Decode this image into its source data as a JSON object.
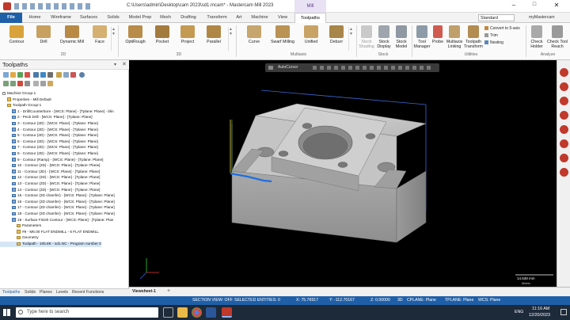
{
  "window": {
    "title": "C:\\Users\\admin\\Desktop\\cam 2023\\sd1.mcam* - Mastercam Mill 2023",
    "context_tab": "Mill",
    "workspace": "Standard",
    "account": "myMastercam"
  },
  "tabs": [
    "File",
    "Home",
    "Wireframe",
    "Surfaces",
    "Solids",
    "Model Prep",
    "Mesh",
    "Drafting",
    "Transform",
    "Art",
    "Machine",
    "View",
    "Toolpaths"
  ],
  "ribbon": {
    "buttons_2d": [
      "Contour",
      "Drill",
      "Dynamic Mill",
      "Face"
    ],
    "buttons_3d": [
      "OptiRough",
      "Pocket",
      "Project",
      "Parallel"
    ],
    "buttons_multiaxis": [
      "Curve",
      "Swarf Milling",
      "Unified",
      "Deburr"
    ],
    "buttons_stock": [
      "Stock Shading",
      "Stock Display",
      "Stock Model"
    ],
    "buttons_utilities": [
      "Tool Manager",
      "Probe",
      "Multiaxis Linking",
      "Toolpath Transform"
    ],
    "utilities_small": [
      "Convert to 5-axis",
      "Trim",
      "Nesting"
    ],
    "buttons_analyze": [
      "Check Holder",
      "Check Tool Reach"
    ],
    "groups": [
      "2D",
      "3D",
      "Multiaxis",
      "Stock",
      "Utilities",
      "Analyze"
    ]
  },
  "toolpaths_panel": {
    "title": "Toolpaths",
    "tree": [
      {
        "indent": 0,
        "kind": "pl",
        "label": "Machine Group-1"
      },
      {
        "indent": 1,
        "kind": "fi",
        "label": "Properties - Mill Default"
      },
      {
        "indent": 1,
        "kind": "fi",
        "label": "Toolpath Group-1"
      },
      {
        "indent": 2,
        "kind": "op",
        "label": "1 - Drill/Counterbore - [WCS: Plane] - [Tplane: Plane] - blin"
      },
      {
        "indent": 2,
        "kind": "op",
        "label": "2 - Peck Drill - [WCS: Plane] - [Tplane: Plane]"
      },
      {
        "indent": 2,
        "kind": "op",
        "label": "3 - Contour (2D) - [WCS: Plane] - [Tplane: Plane]"
      },
      {
        "indent": 2,
        "kind": "op",
        "label": "4 - Contour (2D) - [WCS: Plane] - [Tplane: Plane]"
      },
      {
        "indent": 2,
        "kind": "op",
        "label": "5 - Contour (2D) - [WCS: Plane] - [Tplane: Plane]"
      },
      {
        "indent": 2,
        "kind": "op",
        "label": "6 - Contour (2D) - [WCS: Plane] - [Tplane: Plane]"
      },
      {
        "indent": 2,
        "kind": "op",
        "label": "7 - Contour (2D) - [WCS: Plane] - [Tplane: Plane]"
      },
      {
        "indent": 2,
        "kind": "op",
        "label": "8 - Contour (2D) - [WCS: Plane] - [Tplane: Plane]"
      },
      {
        "indent": 2,
        "kind": "op",
        "label": "9 - Contour (Ramp) - [WCS: Plane] - [Tplane: Plane]"
      },
      {
        "indent": 2,
        "kind": "op",
        "label": "10 - Contour (2D) - [WCS: Plane] - [Tplane: Plane]"
      },
      {
        "indent": 2,
        "kind": "op",
        "label": "11 - Contour (2D) - [WCS: Plane] - [Tplane: Plane]"
      },
      {
        "indent": 2,
        "kind": "op",
        "label": "12 - Contour (2D) - [WCS: Plane] - [Tplane: Plane]"
      },
      {
        "indent": 2,
        "kind": "op",
        "label": "13 - Contour (2D) - [WCS: Plane] - [Tplane: Plane]"
      },
      {
        "indent": 2,
        "kind": "op",
        "label": "14 - Contour (2D) - [WCS: Plane] - [Tplane: Plane]"
      },
      {
        "indent": 2,
        "kind": "op",
        "label": "15 - Contour (2D chamfer) - [WCS: Plane] - [Tplane: Plane]"
      },
      {
        "indent": 2,
        "kind": "op",
        "label": "16 - Contour (2D chamfer) - [WCS: Plane] - [Tplane: Plane]"
      },
      {
        "indent": 2,
        "kind": "op",
        "label": "17 - Contour (2D chamfer) - [WCS: Plane] - [Tplane: Plane]"
      },
      {
        "indent": 2,
        "kind": "op",
        "label": "18 - Contour (2D chamfer) - [WCS: Plane] - [Tplane: Plane]"
      },
      {
        "indent": 2,
        "kind": "op",
        "label": "19 - Surface Finish Contour - [WCS: Plane] - [Tplane: Plan"
      },
      {
        "indent": 3,
        "kind": "fi",
        "label": "Parameters"
      },
      {
        "indent": 3,
        "kind": "fi",
        "label": "#9 - M6.00 FLAT ENDMILL - 6 FLAT ENDMILL"
      },
      {
        "indent": 3,
        "kind": "fi",
        "label": "Geometry"
      },
      {
        "indent": 3,
        "kind": "fi",
        "label": "Toolpath - 105.8K - sd1.NC - Program number 0"
      }
    ]
  },
  "bottom_tabs": [
    "Toolpaths",
    "Solids",
    "Planes",
    "Levels",
    "Recent Functions"
  ],
  "viewport": {
    "autocursor": "AutoCursor",
    "scale": "14.639 mm",
    "unit": "Metric"
  },
  "viewsheet": "Viewsheet-1",
  "status": {
    "section_view": "SECTION VIEW: OFF",
    "selected": "SELECTED ENTITIES: 0",
    "x": "X:  75.76917",
    "y": "Y:  -112.70167",
    "z": "Z:  0.00000",
    "mode": "3D",
    "cplane": "CPLANE: Plane",
    "tplane": "TPLANE: Plane",
    "wcs": "WCS: Plane"
  },
  "taskbar": {
    "search": "Type here to search",
    "time": "11:16 AM",
    "date": "12/20/2023",
    "lang": "ENG"
  }
}
